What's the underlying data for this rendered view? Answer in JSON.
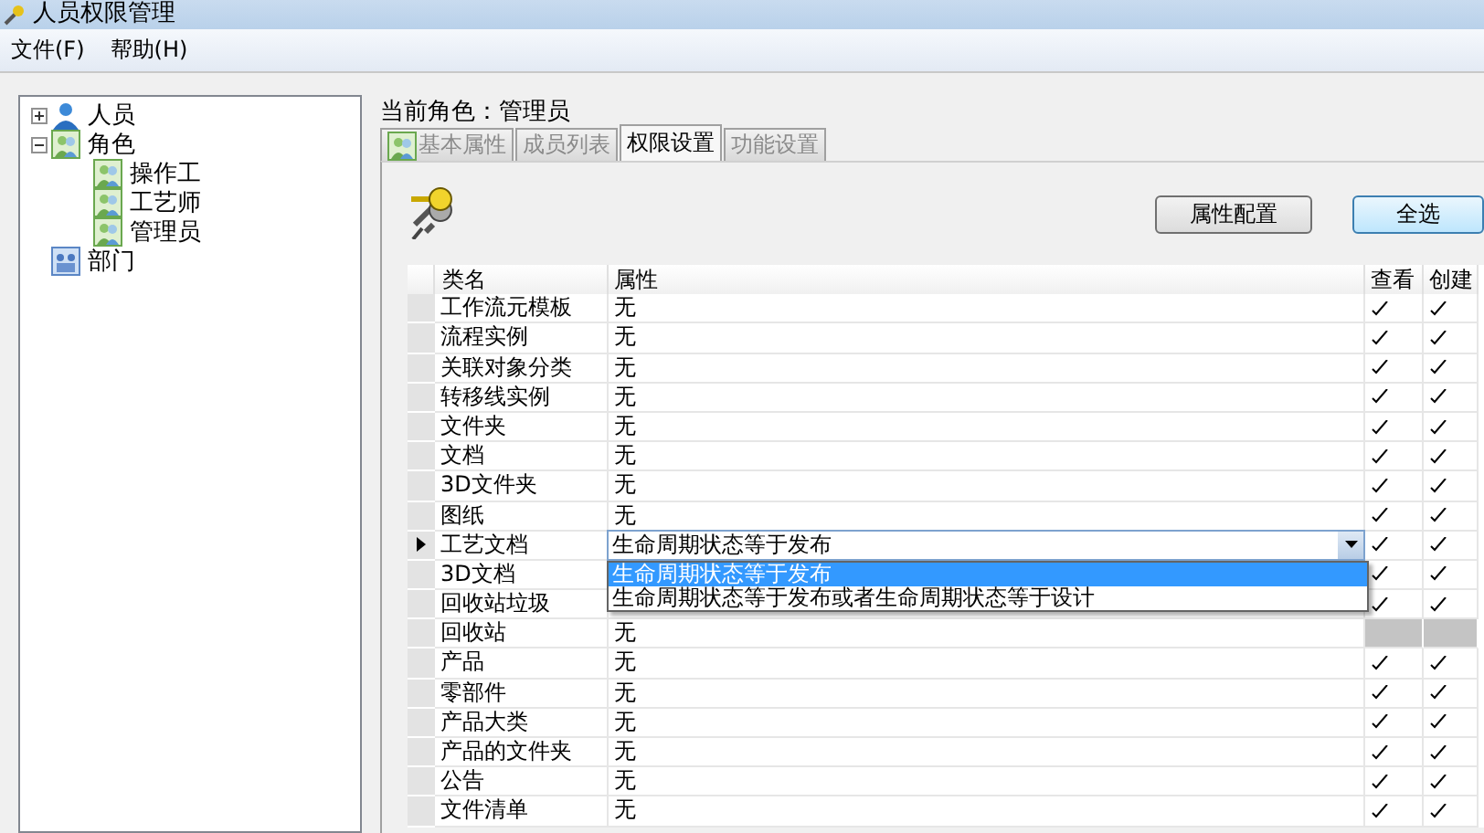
{
  "window": {
    "title": "人员权限管理"
  },
  "menu": [
    "文件(F)",
    "帮助(H)"
  ],
  "tree": [
    {
      "label": "人员",
      "kind": "person",
      "expanded": false
    },
    {
      "label": "角色",
      "kind": "group",
      "expanded": true,
      "children": [
        {
          "label": "操作工",
          "kind": "group"
        },
        {
          "label": "工艺师",
          "kind": "group"
        },
        {
          "label": "管理员",
          "kind": "group"
        }
      ]
    },
    {
      "label": "部门",
      "kind": "dept"
    }
  ],
  "current_role": "当前角色：管理员",
  "tabs": [
    {
      "label": "基本属性",
      "selected": false,
      "icon": true
    },
    {
      "label": "成员列表",
      "selected": false
    },
    {
      "label": "权限设置",
      "selected": true
    },
    {
      "label": "功能设置",
      "selected": false
    }
  ],
  "buttons": [
    {
      "label": "属性配置",
      "focused": false
    },
    {
      "label": "全选",
      "focused": true
    }
  ],
  "table": {
    "columns": [
      "类名",
      "属性",
      "查看",
      "创建"
    ],
    "rows": [
      {
        "name": "工作流元模板",
        "property": "无",
        "current": false,
        "view": true,
        "create": true,
        "disabled": false
      },
      {
        "name": "流程实例",
        "property": "无",
        "current": false,
        "view": true,
        "create": true,
        "disabled": false
      },
      {
        "name": "关联对象分类",
        "property": "无",
        "current": false,
        "view": true,
        "create": true,
        "disabled": false
      },
      {
        "name": "转移线实例",
        "property": "无",
        "current": false,
        "view": true,
        "create": true,
        "disabled": false
      },
      {
        "name": "文件夹",
        "property": "无",
        "current": false,
        "view": true,
        "create": true,
        "disabled": false
      },
      {
        "name": "文档",
        "property": "无",
        "current": false,
        "view": true,
        "create": true,
        "disabled": false
      },
      {
        "name": "3D文件夹",
        "property": "无",
        "current": false,
        "view": true,
        "create": true,
        "disabled": false
      },
      {
        "name": "图纸",
        "property": "无",
        "current": false,
        "view": true,
        "create": true,
        "disabled": false
      },
      {
        "name": "工艺文档",
        "kind": "combo",
        "current": true,
        "property": "生命周期状态等于发布",
        "view": true,
        "create": true,
        "disabled": false,
        "options": [
          {
            "label": "生命周期状态等于发布",
            "selected": true
          },
          {
            "label": "生命周期状态等于发布或者生命周期状态等于设计",
            "selected": false
          }
        ]
      },
      {
        "name": "3D文档",
        "current": false,
        "view": true,
        "create": true,
        "disabled": false
      },
      {
        "name": "回收站垃圾",
        "current": false,
        "view": true,
        "create": true,
        "disabled": false
      },
      {
        "name": "回收站",
        "property": "无",
        "current": false,
        "view": false,
        "create": false,
        "disabled": true
      },
      {
        "name": "产品",
        "property": "无",
        "current": false,
        "view": true,
        "create": true,
        "disabled": false
      },
      {
        "name": "零部件",
        "property": "无",
        "current": false,
        "view": true,
        "create": true,
        "disabled": false
      },
      {
        "name": "产品大类",
        "property": "无",
        "current": false,
        "view": true,
        "create": true,
        "disabled": false
      },
      {
        "name": "产品的文件夹",
        "property": "无",
        "current": false,
        "view": true,
        "create": true,
        "disabled": false
      },
      {
        "name": "公告",
        "property": "无",
        "current": false,
        "view": true,
        "create": true,
        "disabled": false
      },
      {
        "name": "文件清单",
        "property": "无",
        "current": false,
        "view": true,
        "create": true,
        "disabled": false
      }
    ]
  }
}
